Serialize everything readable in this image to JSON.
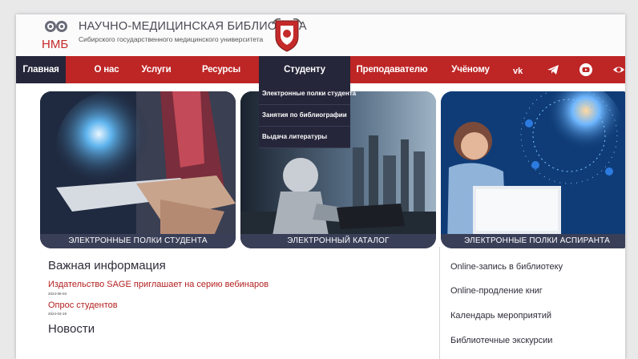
{
  "header": {
    "logo_text": "НМБ",
    "title": "НАУЧНО-МЕДИЦИНСКАЯ БИБЛИОТЕКА",
    "subtitle": "Сибирского государственного медицинского университета"
  },
  "nav": {
    "items": [
      {
        "label": "Главная"
      },
      {
        "label": "О нас"
      },
      {
        "label": "Услуги"
      },
      {
        "label": "Ресурсы"
      },
      {
        "label": "Студенту"
      },
      {
        "label": "Преподавателю"
      },
      {
        "label": "Учёному"
      }
    ],
    "icons": [
      "vk-icon",
      "telegram-icon",
      "youtube-icon",
      "eye-icon"
    ],
    "active_color": "#25263a",
    "bar_color": "#be2525"
  },
  "dropdown": {
    "items": [
      {
        "label": "Электронные полки студента"
      },
      {
        "label": "Занятия по библиографии"
      },
      {
        "label": "Выдача литературы"
      }
    ]
  },
  "cards": [
    {
      "caption": "ЭЛЕКТРОННЫЕ ПОЛКИ СТУДЕНТА"
    },
    {
      "caption": "ЭЛЕКТРОННЫЙ КАТАЛОГ"
    },
    {
      "caption": "ЭЛЕКТРОННЫЕ ПОЛКИ АСПИРАНТА"
    }
  ],
  "info": {
    "title": "Важная информация",
    "items": [
      {
        "text": "Издательство SAGE приглашает на серию вебинаров",
        "date": "2024-06-03"
      },
      {
        "text": "Опрос студентов",
        "date": "2024-03-19"
      }
    ]
  },
  "news": {
    "title": "Новости"
  },
  "right_links": [
    {
      "label": "Online-запись в библиотеку"
    },
    {
      "label": "Online-продление книг"
    },
    {
      "label": "Календарь мероприятий"
    },
    {
      "label": "Библиотечные экскурсии"
    }
  ]
}
